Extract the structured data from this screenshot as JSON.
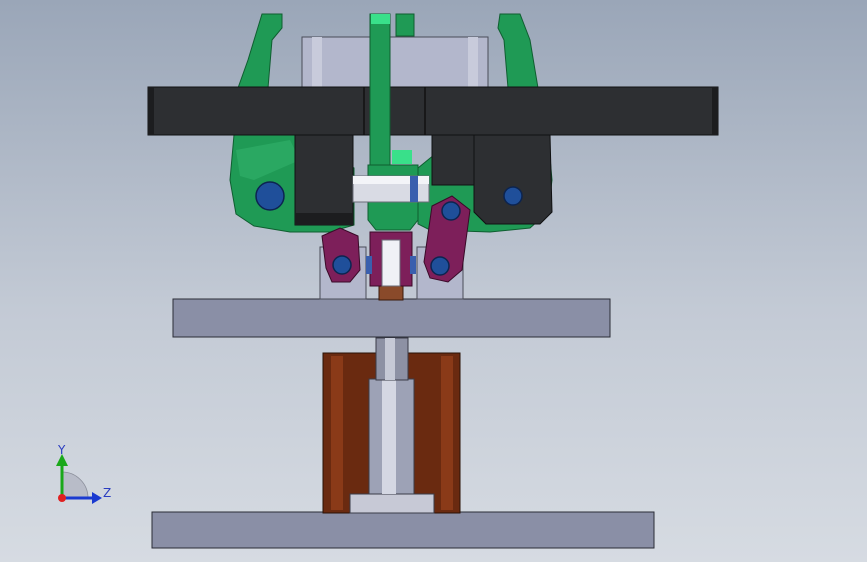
{
  "triad": {
    "y_label": "Y",
    "z_label": "Z"
  },
  "colors": {
    "background_top": "#9aa6b8",
    "background_bottom": "#d6dbe2",
    "clamp_green": "#1f9a55",
    "clamp_green_dark": "#0f5e30",
    "accent_green": "#39e08a",
    "dark_bar": "#2d2f32",
    "link_purple": "#7d1f5a",
    "pin_blue": "#1f4f9a",
    "plate_gray": "#8a8fa6",
    "cylinder_brown": "#6a2a10",
    "rod_silver": "#c9ccd8",
    "block_lavender": "#b3b7cc"
  }
}
